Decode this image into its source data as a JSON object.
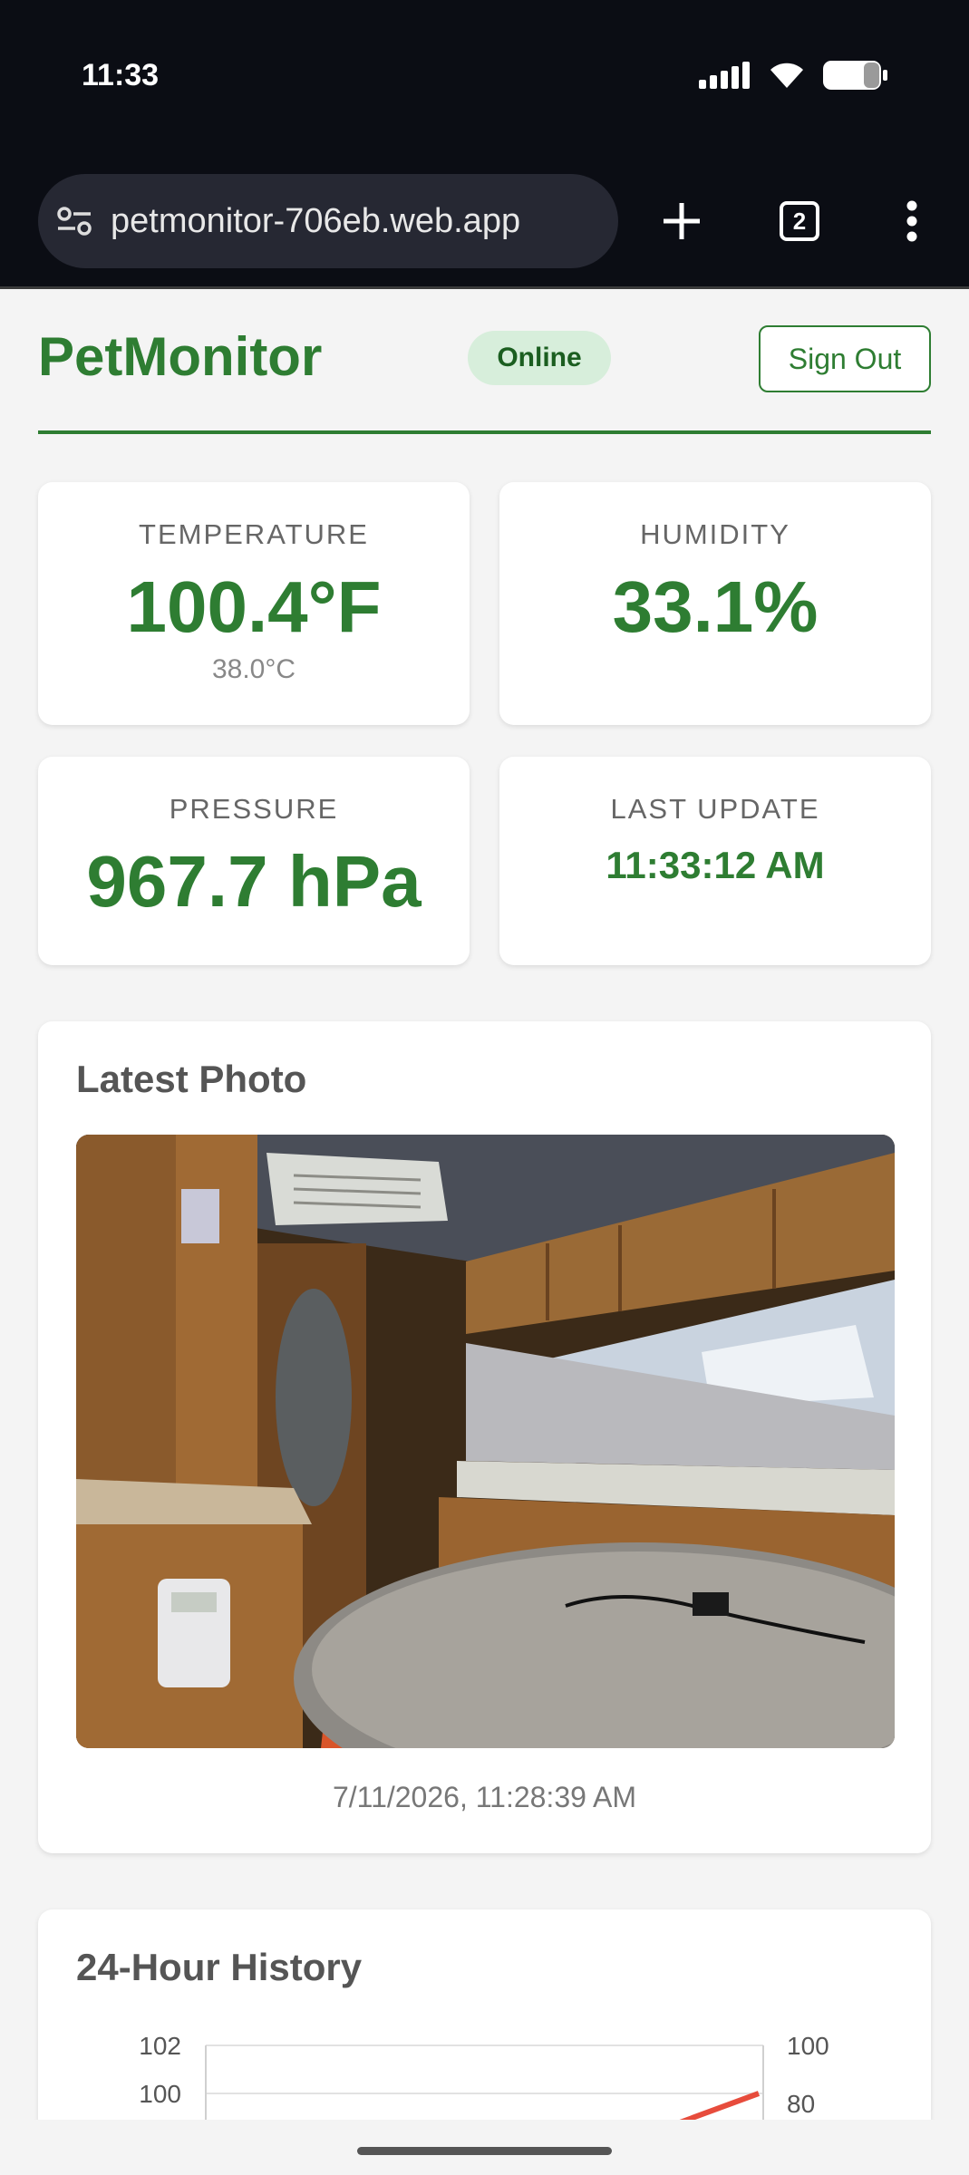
{
  "status_bar": {
    "time": "11:33",
    "battery_icon": "battery-icon",
    "wifi_icon": "wifi-icon",
    "signal_icon": "signal-icon"
  },
  "browser": {
    "url": "petmonitor-706eb.web.app",
    "tab_count": "2",
    "site_settings_icon": "tune-icon",
    "new_tab_icon": "plus-icon",
    "menu_icon": "more-vert-icon"
  },
  "header": {
    "brand": "PetMonitor",
    "status": "Online",
    "sign_out_label": "Sign Out"
  },
  "stats": {
    "temperature": {
      "label": "TEMPERATURE",
      "value": "100.4°F",
      "sub": "38.0°C"
    },
    "humidity": {
      "label": "HUMIDITY",
      "value": "33.1%"
    },
    "pressure": {
      "label": "PRESSURE",
      "value": "967.7 hPa"
    },
    "last_update": {
      "label": "LAST UPDATE",
      "value": "11:33:12 AM"
    }
  },
  "photo": {
    "title": "Latest Photo",
    "timestamp": "7/11/2026, 11:28:39 AM"
  },
  "history": {
    "title": "24-Hour History"
  },
  "chart_data": {
    "type": "line",
    "title": "24-Hour History",
    "y_left_ticks": [
      "102",
      "100"
    ],
    "y_right_ticks": [
      "100",
      "80"
    ],
    "series": [
      {
        "color": "#e74c3c"
      }
    ],
    "grid": true
  },
  "colors": {
    "accent": "#2e7d32",
    "badge_bg": "#d7eedb",
    "series_red": "#e74c3c"
  }
}
